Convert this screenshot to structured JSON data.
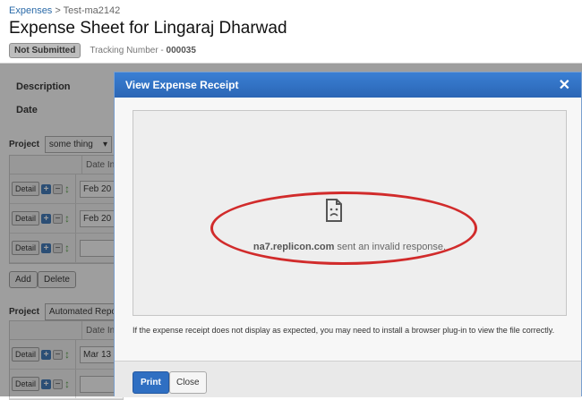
{
  "breadcrumb": {
    "root": "Expenses",
    "separator": " > ",
    "current": "Test-ma2142"
  },
  "page_title": "Expense Sheet for Lingaraj Dharwad",
  "status_badge": "Not Submitted",
  "tracking": {
    "label": "Tracking Number - ",
    "value": "000035"
  },
  "fields": {
    "description": "Description",
    "date": "Date"
  },
  "project1": {
    "label": "Project",
    "value": "some thing"
  },
  "project2": {
    "label": "Project",
    "value": "Automated Reportin"
  },
  "grid1": {
    "header": "Date Inc",
    "rows": [
      {
        "detail": "Detail",
        "date": "Feb 20"
      },
      {
        "detail": "Detail",
        "date": "Feb 20"
      },
      {
        "detail": "Detail",
        "date": ""
      }
    ]
  },
  "grid2": {
    "header": "Date Inc",
    "rows": [
      {
        "detail": "Detail",
        "date": "Mar 13"
      },
      {
        "detail": "Detail",
        "date": ""
      }
    ]
  },
  "actions": {
    "add": "Add",
    "delete": "Delete"
  },
  "modal": {
    "title": "View Expense Receipt",
    "close_glyph": "✕",
    "error_host": "na7.replicon.com",
    "error_msg": " sent an invalid response.",
    "note": "If the expense receipt does not display as expected, you may need to install a browser plug-in to view the file correctly.",
    "print": "Print",
    "close": "Close"
  },
  "colors": {
    "header_blue": "#2f6fc2",
    "annotation_red": "#d12b2b"
  }
}
